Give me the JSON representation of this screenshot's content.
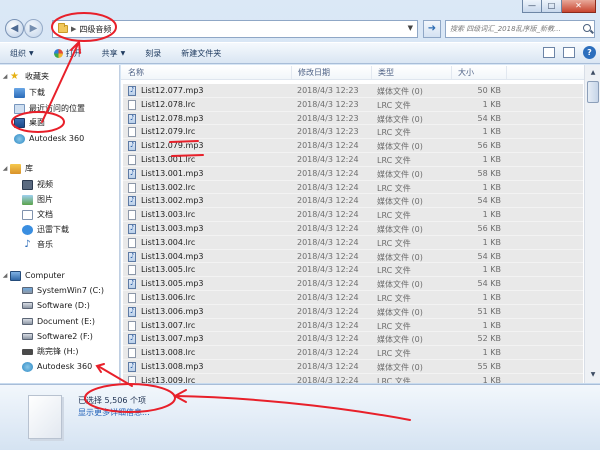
{
  "window": {
    "caption_buttons": [
      "—",
      "□",
      "✕"
    ]
  },
  "address": {
    "path": "四级音频",
    "search_placeholder": "搜索 四级词汇_2018乱序版_新教..."
  },
  "toolbar": {
    "organize": "组织",
    "open": "打开",
    "share": "共享",
    "burn": "刻录",
    "new_folder": "新建文件夹"
  },
  "nav": {
    "favorites": "收藏夹",
    "downloads": "下载",
    "recent": "最近访问的位置",
    "desktop": "桌面",
    "autodesk1": "Autodesk 360",
    "libraries": "库",
    "videos": "视频",
    "pictures": "图片",
    "documents": "文档",
    "xunlei": "迅雷下载",
    "music": "音乐",
    "computer": "Computer",
    "drive_c": "SystemWin7 (C:)",
    "drive_d": "Software (D:)",
    "drive_e": "Document (E:)",
    "drive_f": "Software2 (F:)",
    "drive_h": "跳完锋 (H:)",
    "autodesk2": "Autodesk 360"
  },
  "columns": {
    "name": "名称",
    "date": "修改日期",
    "type": "类型",
    "size": "大小"
  },
  "files": [
    {
      "name": "List12.077.mp3",
      "date": "2018/4/3 12:23",
      "type": "媒体文件 (0)",
      "size": "50 KB",
      "kind": "mp3"
    },
    {
      "name": "List12.078.lrc",
      "date": "2018/4/3 12:23",
      "type": "LRC 文件",
      "size": "1 KB",
      "kind": "lrc"
    },
    {
      "name": "List12.078.mp3",
      "date": "2018/4/3 12:23",
      "type": "媒体文件 (0)",
      "size": "54 KB",
      "kind": "mp3"
    },
    {
      "name": "List12.079.lrc",
      "date": "2018/4/3 12:23",
      "type": "LRC 文件",
      "size": "1 KB",
      "kind": "lrc"
    },
    {
      "name": "List12.079.mp3",
      "date": "2018/4/3 12:24",
      "type": "媒体文件 (0)",
      "size": "56 KB",
      "kind": "mp3"
    },
    {
      "name": "List13.001.lrc",
      "date": "2018/4/3 12:24",
      "type": "LRC 文件",
      "size": "1 KB",
      "kind": "lrc"
    },
    {
      "name": "List13.001.mp3",
      "date": "2018/4/3 12:24",
      "type": "媒体文件 (0)",
      "size": "58 KB",
      "kind": "mp3"
    },
    {
      "name": "List13.002.lrc",
      "date": "2018/4/3 12:24",
      "type": "LRC 文件",
      "size": "1 KB",
      "kind": "lrc"
    },
    {
      "name": "List13.002.mp3",
      "date": "2018/4/3 12:24",
      "type": "媒体文件 (0)",
      "size": "54 KB",
      "kind": "mp3"
    },
    {
      "name": "List13.003.lrc",
      "date": "2018/4/3 12:24",
      "type": "LRC 文件",
      "size": "1 KB",
      "kind": "lrc"
    },
    {
      "name": "List13.003.mp3",
      "date": "2018/4/3 12:24",
      "type": "媒体文件 (0)",
      "size": "56 KB",
      "kind": "mp3"
    },
    {
      "name": "List13.004.lrc",
      "date": "2018/4/3 12:24",
      "type": "LRC 文件",
      "size": "1 KB",
      "kind": "lrc"
    },
    {
      "name": "List13.004.mp3",
      "date": "2018/4/3 12:24",
      "type": "媒体文件 (0)",
      "size": "54 KB",
      "kind": "mp3"
    },
    {
      "name": "List13.005.lrc",
      "date": "2018/4/3 12:24",
      "type": "LRC 文件",
      "size": "1 KB",
      "kind": "lrc"
    },
    {
      "name": "List13.005.mp3",
      "date": "2018/4/3 12:24",
      "type": "媒体文件 (0)",
      "size": "54 KB",
      "kind": "mp3"
    },
    {
      "name": "List13.006.lrc",
      "date": "2018/4/3 12:24",
      "type": "LRC 文件",
      "size": "1 KB",
      "kind": "lrc"
    },
    {
      "name": "List13.006.mp3",
      "date": "2018/4/3 12:24",
      "type": "媒体文件 (0)",
      "size": "51 KB",
      "kind": "mp3"
    },
    {
      "name": "List13.007.lrc",
      "date": "2018/4/3 12:24",
      "type": "LRC 文件",
      "size": "1 KB",
      "kind": "lrc"
    },
    {
      "name": "List13.007.mp3",
      "date": "2018/4/3 12:24",
      "type": "媒体文件 (0)",
      "size": "52 KB",
      "kind": "mp3"
    },
    {
      "name": "List13.008.lrc",
      "date": "2018/4/3 12:24",
      "type": "LRC 文件",
      "size": "1 KB",
      "kind": "lrc"
    },
    {
      "name": "List13.008.mp3",
      "date": "2018/4/3 12:24",
      "type": "媒体文件 (0)",
      "size": "55 KB",
      "kind": "mp3"
    },
    {
      "name": "List13.009.lrc",
      "date": "2018/4/3 12:24",
      "type": "LRC 文件",
      "size": "1 KB",
      "kind": "lrc"
    }
  ],
  "details": {
    "selected": "已选择 5,506 个项",
    "more_link": "显示更多详细信息..."
  },
  "colors": {
    "annotation": "#e8202a",
    "link": "#2060b8",
    "row_selected": "#e9e9e9"
  }
}
